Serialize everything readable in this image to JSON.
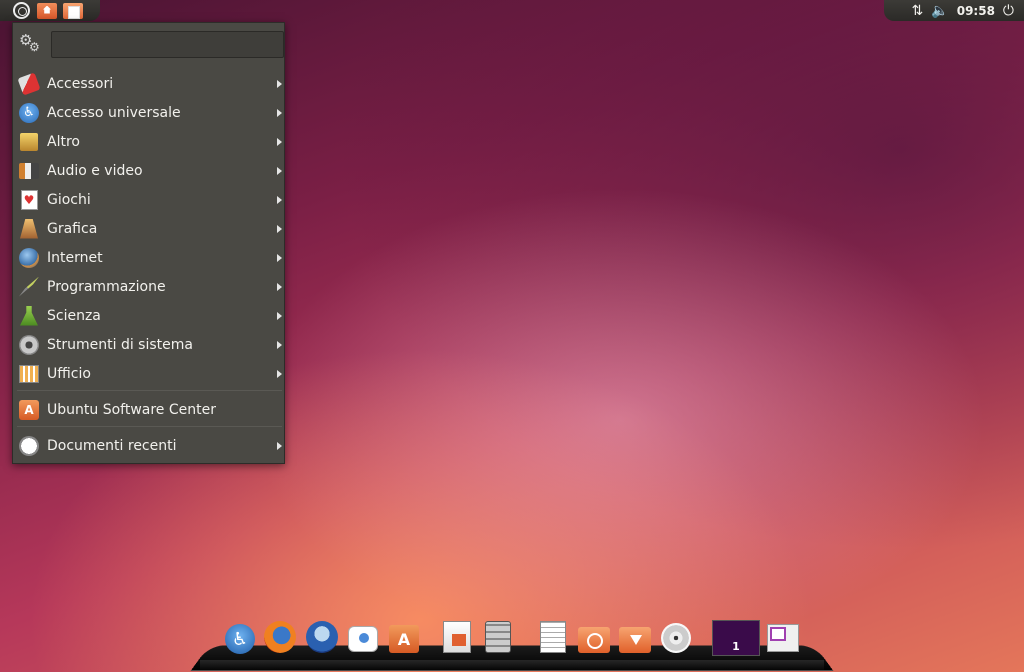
{
  "top_panel": {
    "clock": "09:58",
    "left_icons": [
      "ubuntu-logo-icon",
      "home-folder-icon",
      "documents-folder-icon"
    ],
    "tray_icons": [
      "network-icon",
      "volume-icon",
      "power-icon"
    ]
  },
  "app_menu": {
    "search": {
      "value": "",
      "placeholder": ""
    },
    "categories": [
      {
        "label": "Accessori",
        "icon": "accessories-icon"
      },
      {
        "label": "Accesso universale",
        "icon": "universal-access-icon"
      },
      {
        "label": "Altro",
        "icon": "other-icon"
      },
      {
        "label": "Audio e video",
        "icon": "audio-video-icon"
      },
      {
        "label": "Giochi",
        "icon": "games-icon"
      },
      {
        "label": "Grafica",
        "icon": "graphics-icon"
      },
      {
        "label": "Internet",
        "icon": "internet-icon"
      },
      {
        "label": "Programmazione",
        "icon": "programming-icon"
      },
      {
        "label": "Scienza",
        "icon": "science-icon"
      },
      {
        "label": "Strumenti di sistema",
        "icon": "system-tools-icon"
      },
      {
        "label": "Ufficio",
        "icon": "office-icon"
      }
    ],
    "software_center": {
      "label": "Ubuntu Software Center",
      "icon": "software-center-icon"
    },
    "recent": {
      "label": "Documenti recenti",
      "icon": "recent-documents-icon"
    }
  },
  "dock": {
    "launchers": [
      "universal-access-icon",
      "firefox-icon",
      "thunderbird-icon",
      "empathy-chat-icon",
      "software-center-icon",
      "impress-icon",
      "calculator-icon",
      "text-editor-icon",
      "backup-folder-icon",
      "downloads-folder-icon",
      "disc-icon"
    ],
    "workspace_number": "1"
  },
  "colors": {
    "panel": "#3c3b37",
    "menu_background": "#4a4944",
    "menu_text": "#f2f1ed"
  }
}
